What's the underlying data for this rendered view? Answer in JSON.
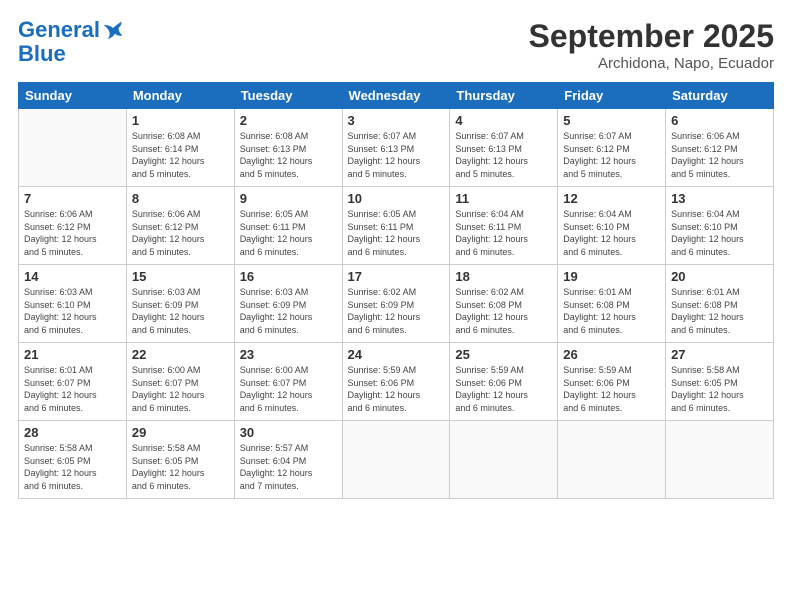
{
  "logo": {
    "line1": "General",
    "line2": "Blue"
  },
  "title": "September 2025",
  "location": "Archidona, Napo, Ecuador",
  "days_header": [
    "Sunday",
    "Monday",
    "Tuesday",
    "Wednesday",
    "Thursday",
    "Friday",
    "Saturday"
  ],
  "weeks": [
    [
      {
        "day": "",
        "info": ""
      },
      {
        "day": "1",
        "info": "Sunrise: 6:08 AM\nSunset: 6:14 PM\nDaylight: 12 hours\nand 5 minutes."
      },
      {
        "day": "2",
        "info": "Sunrise: 6:08 AM\nSunset: 6:13 PM\nDaylight: 12 hours\nand 5 minutes."
      },
      {
        "day": "3",
        "info": "Sunrise: 6:07 AM\nSunset: 6:13 PM\nDaylight: 12 hours\nand 5 minutes."
      },
      {
        "day": "4",
        "info": "Sunrise: 6:07 AM\nSunset: 6:13 PM\nDaylight: 12 hours\nand 5 minutes."
      },
      {
        "day": "5",
        "info": "Sunrise: 6:07 AM\nSunset: 6:12 PM\nDaylight: 12 hours\nand 5 minutes."
      },
      {
        "day": "6",
        "info": "Sunrise: 6:06 AM\nSunset: 6:12 PM\nDaylight: 12 hours\nand 5 minutes."
      }
    ],
    [
      {
        "day": "7",
        "info": "Sunrise: 6:06 AM\nSunset: 6:12 PM\nDaylight: 12 hours\nand 5 minutes."
      },
      {
        "day": "8",
        "info": "Sunrise: 6:06 AM\nSunset: 6:12 PM\nDaylight: 12 hours\nand 5 minutes."
      },
      {
        "day": "9",
        "info": "Sunrise: 6:05 AM\nSunset: 6:11 PM\nDaylight: 12 hours\nand 6 minutes."
      },
      {
        "day": "10",
        "info": "Sunrise: 6:05 AM\nSunset: 6:11 PM\nDaylight: 12 hours\nand 6 minutes."
      },
      {
        "day": "11",
        "info": "Sunrise: 6:04 AM\nSunset: 6:11 PM\nDaylight: 12 hours\nand 6 minutes."
      },
      {
        "day": "12",
        "info": "Sunrise: 6:04 AM\nSunset: 6:10 PM\nDaylight: 12 hours\nand 6 minutes."
      },
      {
        "day": "13",
        "info": "Sunrise: 6:04 AM\nSunset: 6:10 PM\nDaylight: 12 hours\nand 6 minutes."
      }
    ],
    [
      {
        "day": "14",
        "info": "Sunrise: 6:03 AM\nSunset: 6:10 PM\nDaylight: 12 hours\nand 6 minutes."
      },
      {
        "day": "15",
        "info": "Sunrise: 6:03 AM\nSunset: 6:09 PM\nDaylight: 12 hours\nand 6 minutes."
      },
      {
        "day": "16",
        "info": "Sunrise: 6:03 AM\nSunset: 6:09 PM\nDaylight: 12 hours\nand 6 minutes."
      },
      {
        "day": "17",
        "info": "Sunrise: 6:02 AM\nSunset: 6:09 PM\nDaylight: 12 hours\nand 6 minutes."
      },
      {
        "day": "18",
        "info": "Sunrise: 6:02 AM\nSunset: 6:08 PM\nDaylight: 12 hours\nand 6 minutes."
      },
      {
        "day": "19",
        "info": "Sunrise: 6:01 AM\nSunset: 6:08 PM\nDaylight: 12 hours\nand 6 minutes."
      },
      {
        "day": "20",
        "info": "Sunrise: 6:01 AM\nSunset: 6:08 PM\nDaylight: 12 hours\nand 6 minutes."
      }
    ],
    [
      {
        "day": "21",
        "info": "Sunrise: 6:01 AM\nSunset: 6:07 PM\nDaylight: 12 hours\nand 6 minutes."
      },
      {
        "day": "22",
        "info": "Sunrise: 6:00 AM\nSunset: 6:07 PM\nDaylight: 12 hours\nand 6 minutes."
      },
      {
        "day": "23",
        "info": "Sunrise: 6:00 AM\nSunset: 6:07 PM\nDaylight: 12 hours\nand 6 minutes."
      },
      {
        "day": "24",
        "info": "Sunrise: 5:59 AM\nSunset: 6:06 PM\nDaylight: 12 hours\nand 6 minutes."
      },
      {
        "day": "25",
        "info": "Sunrise: 5:59 AM\nSunset: 6:06 PM\nDaylight: 12 hours\nand 6 minutes."
      },
      {
        "day": "26",
        "info": "Sunrise: 5:59 AM\nSunset: 6:06 PM\nDaylight: 12 hours\nand 6 minutes."
      },
      {
        "day": "27",
        "info": "Sunrise: 5:58 AM\nSunset: 6:05 PM\nDaylight: 12 hours\nand 6 minutes."
      }
    ],
    [
      {
        "day": "28",
        "info": "Sunrise: 5:58 AM\nSunset: 6:05 PM\nDaylight: 12 hours\nand 6 minutes."
      },
      {
        "day": "29",
        "info": "Sunrise: 5:58 AM\nSunset: 6:05 PM\nDaylight: 12 hours\nand 6 minutes."
      },
      {
        "day": "30",
        "info": "Sunrise: 5:57 AM\nSunset: 6:04 PM\nDaylight: 12 hours\nand 7 minutes."
      },
      {
        "day": "",
        "info": ""
      },
      {
        "day": "",
        "info": ""
      },
      {
        "day": "",
        "info": ""
      },
      {
        "day": "",
        "info": ""
      }
    ]
  ]
}
